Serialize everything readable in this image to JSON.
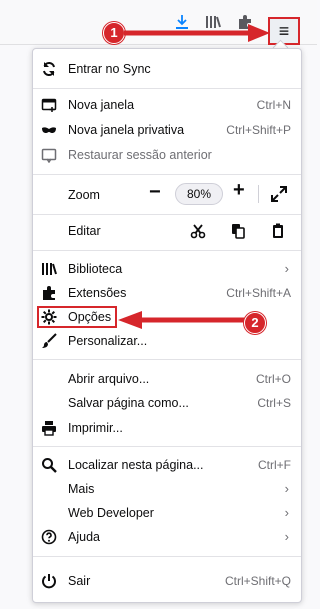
{
  "toolbar": {
    "icons": [
      "download-icon",
      "library-icon",
      "extension-icon",
      "hamburger-menu-icon"
    ],
    "menu_button_symbol": "≡"
  },
  "menu": {
    "sync": {
      "label": "Entrar no Sync"
    },
    "new_window": {
      "label": "Nova janela",
      "shortcut": "Ctrl+N"
    },
    "private_window": {
      "label": "Nova janela privativa",
      "shortcut": "Ctrl+Shift+P"
    },
    "restore_session": {
      "label": "Restaurar sessão anterior"
    },
    "zoom": {
      "label": "Zoom",
      "minus": "−",
      "value": "80%",
      "plus": "+"
    },
    "edit": {
      "label": "Editar"
    },
    "library": {
      "label": "Biblioteca",
      "chevron": "›"
    },
    "extensions": {
      "label": "Extensões",
      "shortcut": "Ctrl+Shift+A"
    },
    "options": {
      "label": "Opções"
    },
    "customize": {
      "label": "Personalizar..."
    },
    "open_file": {
      "label": "Abrir arquivo...",
      "shortcut": "Ctrl+O"
    },
    "save_page": {
      "label": "Salvar página como...",
      "shortcut": "Ctrl+S"
    },
    "print": {
      "label": "Imprimir..."
    },
    "find": {
      "label": "Localizar nesta página...",
      "shortcut": "Ctrl+F"
    },
    "more": {
      "label": "Mais",
      "chevron": "›"
    },
    "web_dev": {
      "label": "Web Developer",
      "chevron": "›"
    },
    "help": {
      "label": "Ajuda",
      "chevron": "›"
    },
    "quit": {
      "label": "Sair",
      "shortcut": "Ctrl+Shift+Q"
    }
  },
  "annotations": {
    "step1": "1",
    "step2": "2",
    "color": "#d6262b"
  }
}
